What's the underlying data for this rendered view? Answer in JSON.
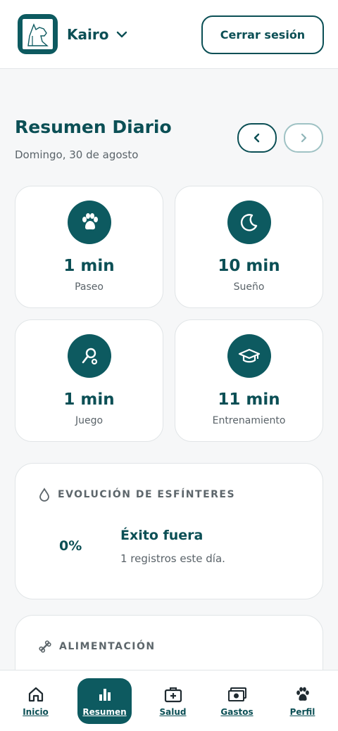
{
  "header": {
    "pet_name": "Kairo",
    "logout_label": "Cerrar sesión"
  },
  "summary": {
    "title": "Resumen Diario",
    "date": "Domingo, 30 de agosto"
  },
  "stats": [
    {
      "value": "1 min",
      "label": "Paseo",
      "icon": "paw-icon"
    },
    {
      "value": "10 min",
      "label": "Sueño",
      "icon": "moon-icon"
    },
    {
      "value": "1 min",
      "label": "Juego",
      "icon": "ball-toy-icon"
    },
    {
      "value": "11 min",
      "label": "Entrenamiento",
      "icon": "graduation-cap-icon"
    }
  ],
  "potty": {
    "title": "EVOLUCIÓN DE ESFÍNTERES",
    "percent": "0%",
    "result_title": "Éxito fuera",
    "result_sub": "1 registros este día."
  },
  "feeding": {
    "title": "ALIMENTACIÓN"
  },
  "bottom_nav": [
    {
      "label": "Inicio",
      "icon": "home-icon"
    },
    {
      "label": "Resumen",
      "icon": "bar-chart-icon",
      "active": true
    },
    {
      "label": "Salud",
      "icon": "first-aid-icon"
    },
    {
      "label": "Gastos",
      "icon": "money-icon"
    },
    {
      "label": "Perfil",
      "icon": "paw-icon"
    }
  ],
  "colors": {
    "primary": "#0d5a60",
    "text_dark": "#0b4f55",
    "muted": "#5a6369",
    "background": "#f6f7f8"
  }
}
